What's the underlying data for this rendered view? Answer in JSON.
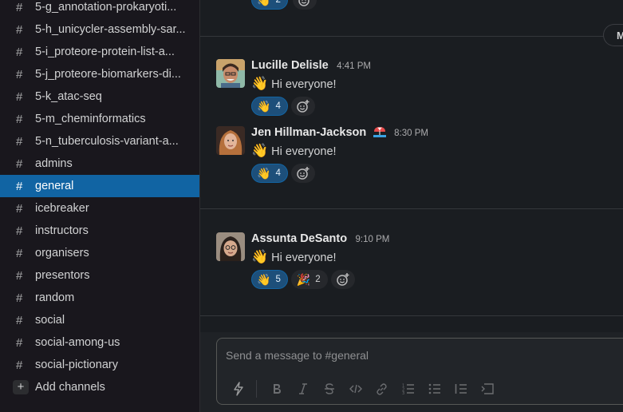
{
  "sidebar": {
    "channels": [
      {
        "name": "5-g_annotation-prokaryoti..."
      },
      {
        "name": "5-h_unicycler-assembly-sar..."
      },
      {
        "name": "5-i_proteore-protein-list-a..."
      },
      {
        "name": "5-j_proteore-biomarkers-di..."
      },
      {
        "name": "5-k_atac-seq"
      },
      {
        "name": "5-m_cheminformatics"
      },
      {
        "name": "5-n_tuberculosis-variant-a..."
      },
      {
        "name": "admins"
      },
      {
        "name": "general",
        "active": true
      },
      {
        "name": "icebreaker"
      },
      {
        "name": "instructors"
      },
      {
        "name": "organisers"
      },
      {
        "name": "presentors"
      },
      {
        "name": "random"
      },
      {
        "name": "social"
      },
      {
        "name": "social-among-us"
      },
      {
        "name": "social-pictionary"
      }
    ],
    "hash_symbol": "#",
    "add_channels_label": "Add channels",
    "add_symbol": "+"
  },
  "main": {
    "date_pill_label": "M",
    "top_reaction_count": "2",
    "messages": [
      {
        "author": "Lucille Delisle",
        "time": "4:41 PM",
        "text": "Hi everyone!",
        "emoji": "👋",
        "reactions": [
          {
            "emoji": "👋",
            "count": "4",
            "mine": true
          }
        ]
      },
      {
        "author": "Jen Hillman-Jackson",
        "time": "8:30 PM",
        "text": "Hi everyone!",
        "emoji": "👋",
        "status_icon": "beach-icon",
        "reactions": [
          {
            "emoji": "👋",
            "count": "4",
            "mine": true
          }
        ]
      },
      {
        "author": "Assunta DeSanto",
        "time": "9:10 PM",
        "text": "Hi everyone!",
        "emoji": "👋",
        "reactions": [
          {
            "emoji": "👋",
            "count": "5",
            "mine": true
          },
          {
            "emoji": "🎉",
            "count": "2",
            "mine": false
          }
        ]
      }
    ]
  },
  "composer": {
    "placeholder": "Send a message to #general",
    "toolbar_icons": [
      "shortcuts-icon",
      "bold-icon",
      "italic-icon",
      "strikethrough-icon",
      "code-icon",
      "link-icon",
      "ordered-list-icon",
      "bulleted-list-icon",
      "blockquote-icon",
      "code-block-icon"
    ]
  },
  "colors": {
    "sidebar_bg": "#19171d",
    "active_channel": "#1164a3",
    "main_bg": "#1a1d21",
    "reaction_mine": "#1d4f7a"
  }
}
